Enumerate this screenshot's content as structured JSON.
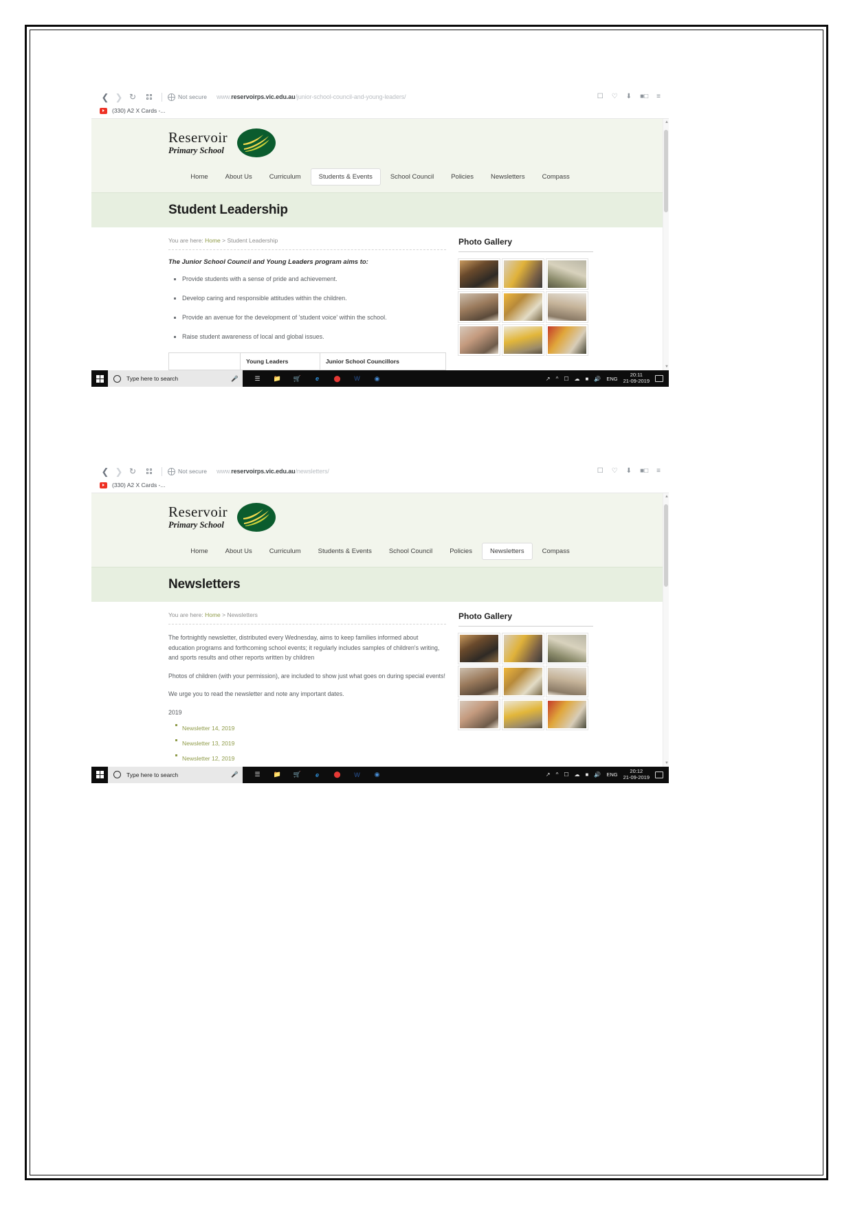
{
  "document": {
    "page_background": "#ffffff",
    "frame_color": "#0a0a0a"
  },
  "screenshots": [
    {
      "id": "screenshot-student-leadership",
      "browser": {
        "back_icon": "back-arrow-icon",
        "forward_icon": "forward-arrow-icon",
        "reload_icon": "reload-icon",
        "apps_icon": "apps-grid-icon",
        "site_info_icon": "globe-icon",
        "security_label": "Not secure",
        "url_scheme": "www.",
        "url_domain": "reservoirps.vic.edu.au",
        "url_path": "/junior-school-council-and-young-leaders/",
        "toolbar_icons": [
          "screenshot-icon",
          "heart-icon",
          "download-icon",
          "collections-icon",
          "menu-icon"
        ],
        "bookmark": {
          "favicon": "youtube-icon",
          "label": "(330) A2 X Cards -..."
        }
      },
      "site": {
        "brand_name": "Reservoir",
        "brand_sub": "Primary School",
        "logo": "green-oval-leaf-logo",
        "nav": [
          {
            "label": "Home",
            "active": false
          },
          {
            "label": "About Us",
            "active": false
          },
          {
            "label": "Curriculum",
            "active": false
          },
          {
            "label": "Students & Events",
            "active": true
          },
          {
            "label": "School Council",
            "active": false
          },
          {
            "label": "Policies",
            "active": false
          },
          {
            "label": "Newsletters",
            "active": false
          },
          {
            "label": "Compass",
            "active": false
          }
        ],
        "page_title": "Student Leadership",
        "breadcrumb_prefix": "You are here:",
        "breadcrumb_home": "Home",
        "breadcrumb_sep": ">",
        "breadcrumb_current": "Student Leadership",
        "lead": "The Junior School Council and Young Leaders program aims to:",
        "aims": [
          "Provide students with a sense of pride and achievement.",
          "Develop caring and responsible attitudes within the children.",
          "Provide an avenue for the development of 'student voice' within the school.",
          "Raise student awareness of local and global issues."
        ],
        "table": {
          "headers": [
            "",
            "Young Leaders",
            "Junior School Councillors"
          ]
        },
        "gallery_title": "Photo Gallery",
        "gallery_count": 9
      },
      "taskbar": {
        "search_placeholder": "Type here to search",
        "cortana_icon": "circle-icon",
        "mic_icon": "microphone-icon",
        "apps": [
          "task-view-icon",
          "file-explorer-icon",
          "store-icon",
          "edge-icon",
          "opera-icon",
          "word-icon",
          "chrome-icon"
        ],
        "tray": [
          "share-icon",
          "chevron-up-icon",
          "network-icon",
          "onedrive-icon",
          "battery-icon",
          "volume-icon"
        ],
        "language": "ENG",
        "time": "20:11",
        "date": "21-09-2019",
        "notification_icon": "notification-icon"
      }
    },
    {
      "id": "screenshot-newsletters",
      "browser": {
        "back_icon": "back-arrow-icon",
        "forward_icon": "forward-arrow-icon",
        "reload_icon": "reload-icon",
        "apps_icon": "apps-grid-icon",
        "site_info_icon": "globe-icon",
        "security_label": "Not secure",
        "url_scheme": "www.",
        "url_domain": "reservoirps.vic.edu.au",
        "url_path": "/newsletters/",
        "toolbar_icons": [
          "screenshot-icon",
          "heart-icon",
          "download-icon",
          "collections-icon",
          "menu-icon"
        ],
        "bookmark": {
          "favicon": "youtube-icon",
          "label": "(330) A2 X Cards -..."
        }
      },
      "site": {
        "brand_name": "Reservoir",
        "brand_sub": "Primary School",
        "logo": "green-oval-leaf-logo",
        "nav": [
          {
            "label": "Home",
            "active": false
          },
          {
            "label": "About Us",
            "active": false
          },
          {
            "label": "Curriculum",
            "active": false
          },
          {
            "label": "Students & Events",
            "active": false
          },
          {
            "label": "School Council",
            "active": false
          },
          {
            "label": "Policies",
            "active": false
          },
          {
            "label": "Newsletters",
            "active": true
          },
          {
            "label": "Compass",
            "active": false
          }
        ],
        "page_title": "Newsletters",
        "breadcrumb_prefix": "You are here:",
        "breadcrumb_home": "Home",
        "breadcrumb_sep": ">",
        "breadcrumb_current": "Newsletters",
        "paragraphs": [
          "The fortnightly newsletter, distributed every Wednesday, aims to keep families informed about education programs and forthcoming school events; it regularly includes samples of children's writing, and sports results and other reports written by children",
          "Photos of children (with your permission), are included to show just what goes on during special events!",
          "We urge you to read the newsletter and note any important dates."
        ],
        "year": "2019",
        "newsletter_links": [
          "Newsletter 14, 2019",
          "Newsletter 13, 2019",
          "Newsletter 12, 2019"
        ],
        "gallery_title": "Photo Gallery",
        "gallery_count": 9
      },
      "taskbar": {
        "search_placeholder": "Type here to search",
        "cortana_icon": "circle-icon",
        "mic_icon": "microphone-icon",
        "apps": [
          "task-view-icon",
          "file-explorer-icon",
          "store-icon",
          "edge-icon",
          "opera-icon",
          "word-icon",
          "chrome-icon"
        ],
        "tray": [
          "share-icon",
          "chevron-up-icon",
          "network-icon",
          "onedrive-icon",
          "battery-icon",
          "volume-icon"
        ],
        "language": "ENG",
        "time": "20:12",
        "date": "21-09-2019",
        "notification_icon": "notification-icon"
      }
    }
  ]
}
